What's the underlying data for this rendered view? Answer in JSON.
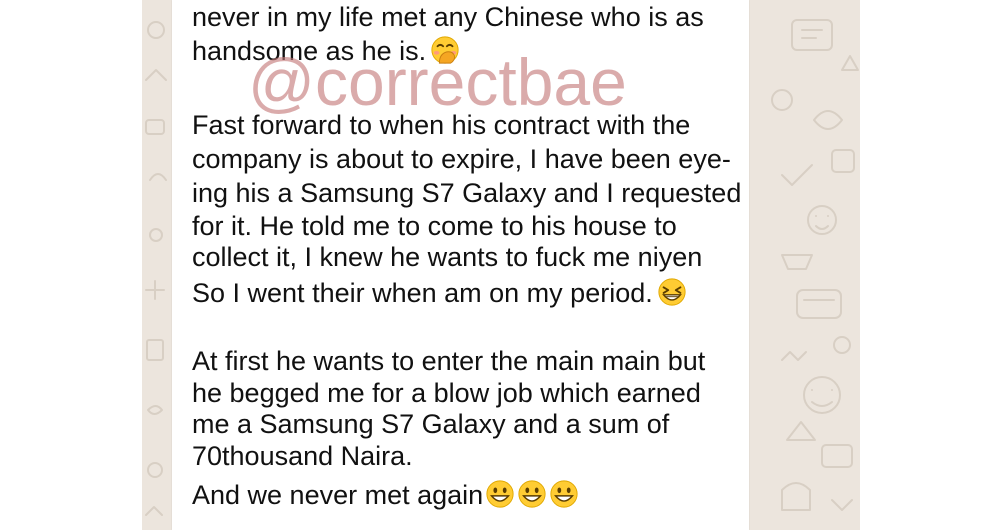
{
  "message": {
    "lines": [
      "never in my life met any Chinese who is as",
      "handsome as he is.",
      "Fast forward to when his contract with the",
      "company is about to expire, I have been eye-",
      "ing his a Samsung S7 Galaxy and I requested",
      "for it. He told me to come to his house to",
      "collect it, I knew  he wants to fuck me niyen",
      "So I went their when am on my period.",
      "At first he wants to enter the main main but",
      "he begged me for a blow job which earned",
      "me a Samsung S7 Galaxy and a sum of",
      "70thousand Naira.",
      "And we never met again"
    ]
  },
  "watermark": {
    "text": "@correctbae",
    "color": "#c47878"
  },
  "icons": {
    "line2_emoji": "face-with-hand-over-mouth-icon",
    "line8_emoji": "grinning-squinting-face-icon",
    "line13_emoji": "grinning-face-icon"
  },
  "colors": {
    "wallpaper": "#ece5dd",
    "bubble": "#ffffff",
    "text": "#111111"
  }
}
